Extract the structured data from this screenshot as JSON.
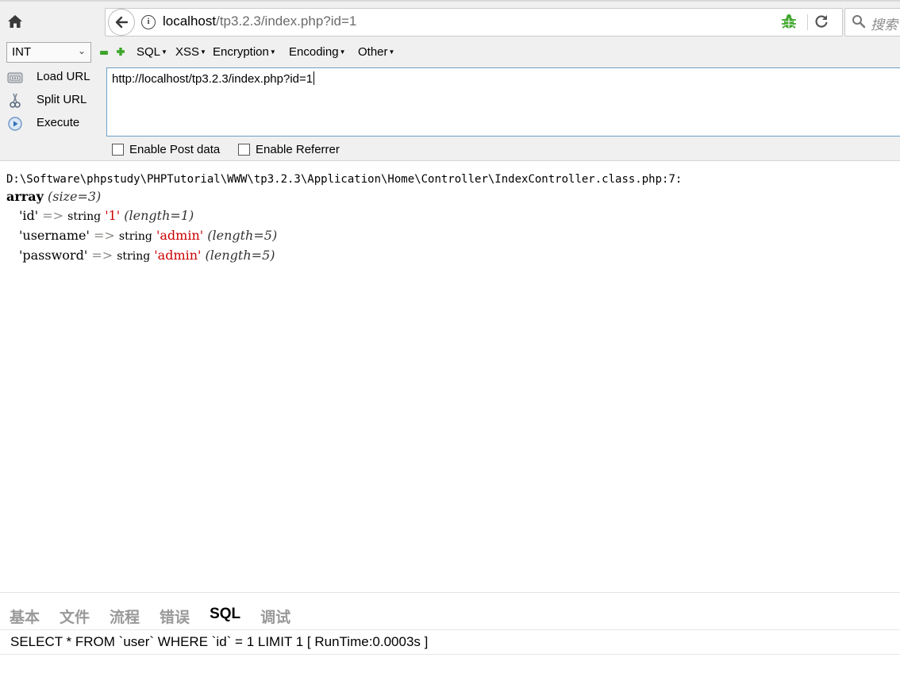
{
  "browser": {
    "url_host": "localhost",
    "url_path": "/tp3.2.3/index.php?id=1",
    "search_placeholder": "搜索"
  },
  "hackbar": {
    "select_value": "INT",
    "menus": [
      "SQL",
      "XSS",
      "Encryption",
      "Encoding",
      "Other"
    ],
    "buttons": {
      "load": "Load URL",
      "split": "Split URL",
      "execute": "Execute"
    },
    "url_value": "http://localhost/tp3.2.3/index.php?id=1",
    "post_label": "Enable Post data",
    "referrer_label": "Enable Referrer"
  },
  "dump": {
    "path": "D:\\Software\\phpstudy\\PHPTutorial\\WWW\\tp3.2.3\\Application\\Home\\Controller\\IndexController.class.php:7:",
    "type": "array",
    "size": "(size=3)",
    "rows": [
      {
        "key": "'id'",
        "type": "string",
        "value": "'1'",
        "length": "(length=1)"
      },
      {
        "key": "'username'",
        "type": "string",
        "value": "'admin'",
        "length": "(length=5)"
      },
      {
        "key": "'password'",
        "type": "string",
        "value": "'admin'",
        "length": "(length=5)"
      }
    ]
  },
  "trace": {
    "tabs": [
      "基本",
      "文件",
      "流程",
      "错误",
      "SQL",
      "调试"
    ],
    "active_tab": "SQL",
    "sql": "SELECT * FROM `user` WHERE `id` = 1 LIMIT 1 [ RunTime:0.0003s ]"
  },
  "colors": {
    "toolbar_bg": "#f0f0f0",
    "dump_value": "#cc0000",
    "dump_arrow": "#888a85",
    "tab_inactive": "#999999",
    "bug_icon": "#3ea52b"
  }
}
